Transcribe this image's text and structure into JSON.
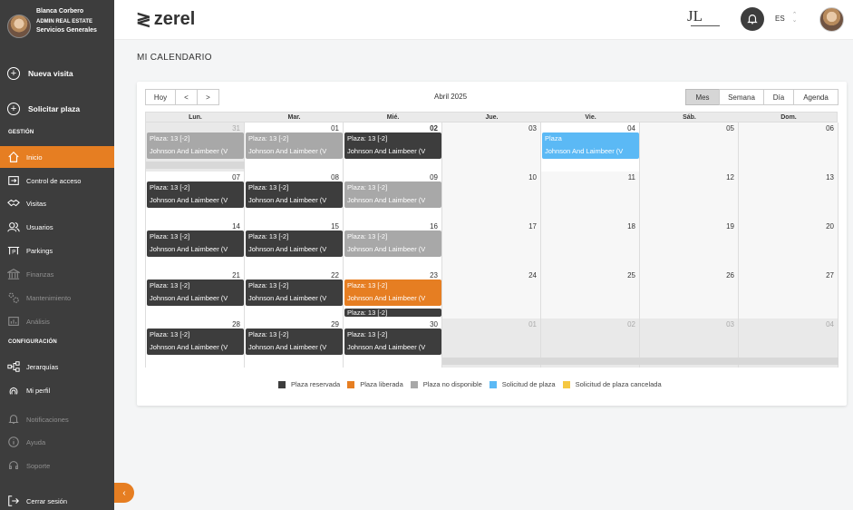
{
  "colors": {
    "sidebar": "#3d3d3d",
    "accent": "#e67e22",
    "reserved": "#3d3d3d",
    "released": "#e67e22",
    "unavailable": "#a8a8a8",
    "request": "#5bb9f5",
    "cancelled": "#f5c842"
  },
  "user": {
    "name": "Blanca Corbero",
    "role": "ADMIN REAL ESTATE",
    "dept": "Servicios Generales"
  },
  "sidebar": {
    "actions": [
      {
        "label": "Nueva visita",
        "icon": "plus-circle-icon"
      },
      {
        "label": "Solicitar plaza",
        "icon": "plus-circle-icon"
      }
    ],
    "section_gestion": "GESTIÓN",
    "gestion_items": [
      {
        "label": "Inicio",
        "icon": "home-icon"
      },
      {
        "label": "Control de acceso",
        "icon": "access-icon"
      },
      {
        "label": "Visitas",
        "icon": "handshake-icon"
      },
      {
        "label": "Usuarios",
        "icon": "users-icon"
      },
      {
        "label": "Parkings",
        "icon": "parking-icon"
      },
      {
        "label": "Finanzas",
        "icon": "bank-icon"
      },
      {
        "label": "Mantenimiento",
        "icon": "gears-icon"
      },
      {
        "label": "Análisis",
        "icon": "chart-icon"
      }
    ],
    "section_config": "CONFIGURACIÓN",
    "config_items": [
      {
        "label": "Jerarquías",
        "icon": "hierarchy-icon"
      },
      {
        "label": "Mi perfil",
        "icon": "fingerprint-icon"
      },
      {
        "label": "Notificaciones",
        "icon": "bell-icon"
      },
      {
        "label": "Ayuda",
        "icon": "info-icon"
      },
      {
        "label": "Soporte",
        "icon": "headset-icon"
      }
    ],
    "logout": "Cerrar sesión",
    "collapse": "‹"
  },
  "header": {
    "brand": "zerel",
    "client_logo": "JL",
    "language": "ES"
  },
  "page_title": "MI CALENDARIO",
  "calendar": {
    "buttons": {
      "today": "Hoy",
      "prev": "<",
      "next": ">"
    },
    "title": "Abril 2025",
    "views": [
      "Mes",
      "Semana",
      "Día",
      "Agenda"
    ],
    "active_view": "Mes",
    "weekdays": [
      "Lun.",
      "Mar.",
      "Mié.",
      "Jue.",
      "Vie.",
      "Sáb.",
      "Dom."
    ],
    "weeks": [
      [
        "31",
        "01",
        "02",
        "03",
        "04",
        "05",
        "06"
      ],
      [
        "07",
        "08",
        "09",
        "10",
        "11",
        "12",
        "13"
      ],
      [
        "14",
        "15",
        "16",
        "17",
        "18",
        "19",
        "20"
      ],
      [
        "21",
        "22",
        "23",
        "24",
        "25",
        "26",
        "27"
      ],
      [
        "28",
        "29",
        "30",
        "01",
        "02",
        "03",
        "04"
      ]
    ],
    "event_line1": "Plaza: 13 [-2]",
    "event_line2": "Johnson And Laimbeer (V",
    "request_line1": "Plaza",
    "events": [
      {
        "week": 0,
        "day": 0,
        "status": "unavailable"
      },
      {
        "week": 0,
        "day": 1,
        "status": "unavailable"
      },
      {
        "week": 0,
        "day": 2,
        "status": "reserved"
      },
      {
        "week": 0,
        "day": 4,
        "status": "request"
      },
      {
        "week": 1,
        "day": 0,
        "status": "reserved"
      },
      {
        "week": 1,
        "day": 1,
        "status": "reserved"
      },
      {
        "week": 1,
        "day": 2,
        "status": "unavailable"
      },
      {
        "week": 2,
        "day": 0,
        "status": "reserved"
      },
      {
        "week": 2,
        "day": 1,
        "status": "reserved"
      },
      {
        "week": 2,
        "day": 2,
        "status": "unavailable"
      },
      {
        "week": 3,
        "day": 0,
        "status": "reserved"
      },
      {
        "week": 3,
        "day": 1,
        "status": "reserved"
      },
      {
        "week": 3,
        "day": 2,
        "status": "released"
      },
      {
        "week": 4,
        "day": 0,
        "status": "reserved"
      },
      {
        "week": 4,
        "day": 1,
        "status": "reserved"
      },
      {
        "week": 4,
        "day": 2,
        "status": "reserved"
      }
    ],
    "legend": [
      {
        "label": "Plaza reservada",
        "color": "#3d3d3d"
      },
      {
        "label": "Plaza liberada",
        "color": "#e67e22"
      },
      {
        "label": "Plaza no disponible",
        "color": "#a8a8a8"
      },
      {
        "label": "Solicitud de plaza",
        "color": "#5bb9f5"
      },
      {
        "label": "Solicitud de plaza cancelada",
        "color": "#f5c842"
      }
    ]
  }
}
